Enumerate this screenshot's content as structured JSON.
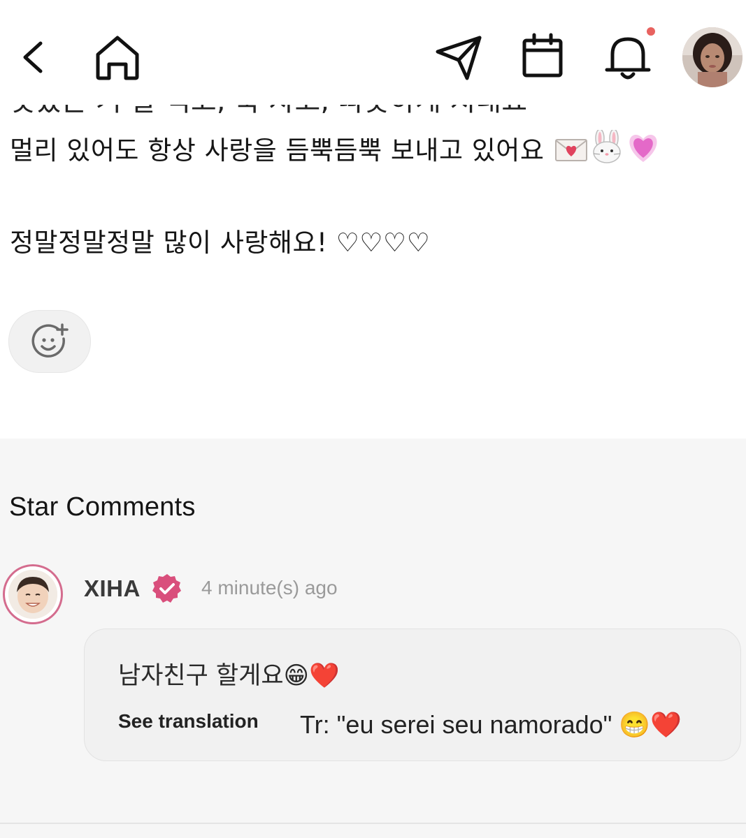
{
  "header": {
    "icons": [
      "back-icon",
      "home-icon",
      "send-icon",
      "calendar-icon",
      "bell-icon"
    ],
    "has_notification_dot": true,
    "notification_dot_color": "#e8625f"
  },
  "post": {
    "clipped_text": "맛있는 거 잘 먹고, 푹 자고, 따뜻하게 지내요",
    "line1_text": "멀리 있어도 항상 사랑을 듬뿍듬뿍 보내고 있어요",
    "line1_emojis": [
      "💌",
      "🐰",
      "💗"
    ],
    "line2_text": "정말정말정말 많이 사랑해요! ♡♡♡♡"
  },
  "comments": {
    "section_title": "Star Comments",
    "items": [
      {
        "author": "XIHA",
        "verified": true,
        "time": "4 minute(s) ago",
        "text": "남자친구 할게요😁❤️",
        "see_translation_label": "See translation",
        "translation": "Tr: \"eu serei seu namorado\" 😁❤️"
      }
    ]
  },
  "colors": {
    "accent_pink": "#d94f7c",
    "section_bg": "#f6f6f6",
    "bubble_bg": "#f1f1f1",
    "time_gray": "#9a9a9a"
  }
}
